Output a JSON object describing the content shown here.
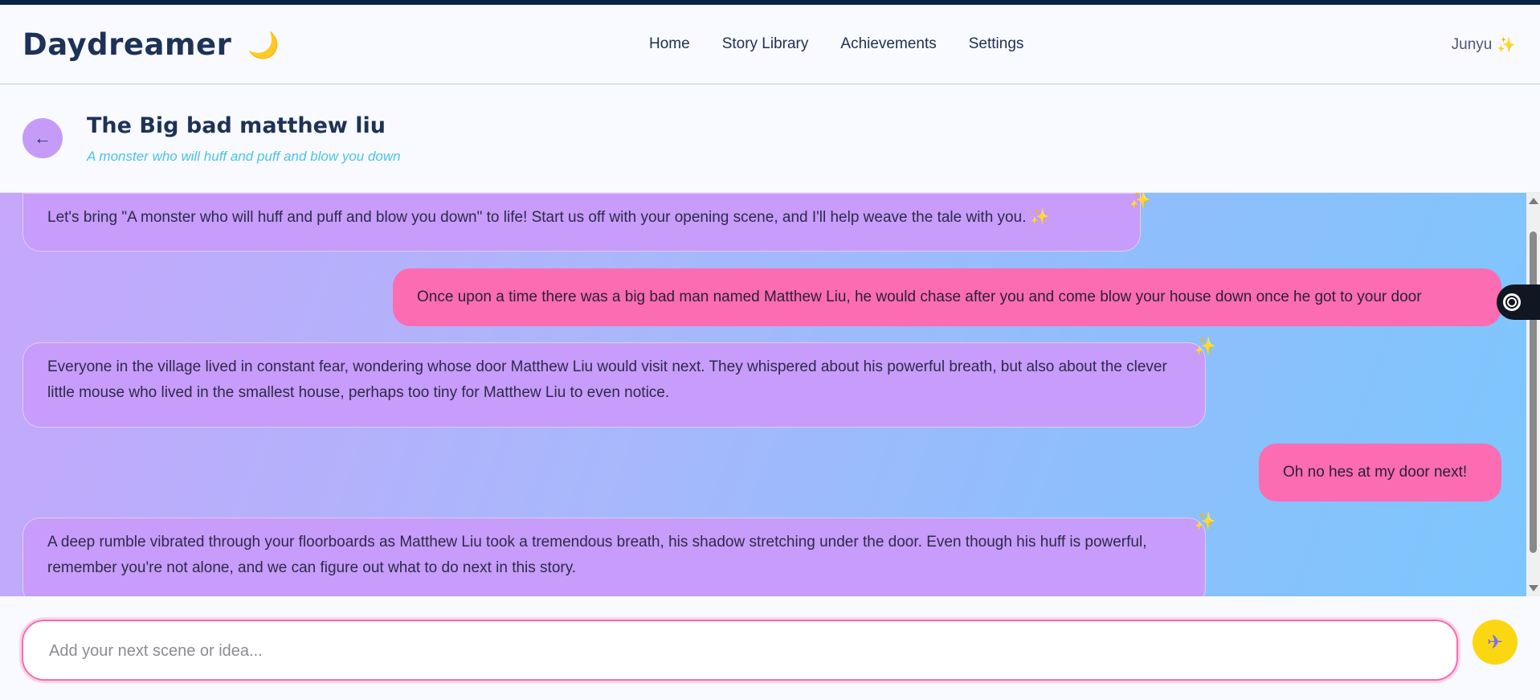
{
  "brand": {
    "name": "Daydreamer",
    "moon_icon": "🌙"
  },
  "nav": [
    "Home",
    "Story Library",
    "Achievements",
    "Settings"
  ],
  "user": {
    "name": "Junyu",
    "sparkle": "✨"
  },
  "story": {
    "back_label": "←",
    "title": "The Big bad matthew liu",
    "subtitle": "A monster who will huff and puff and blow you down"
  },
  "messages": [
    {
      "role": "ai",
      "text": "Let's bring \"A monster who will huff and puff and blow you down\" to life! Start us off with your opening scene, and I'll help weave the tale with you. ✨"
    },
    {
      "role": "user",
      "text": "Once upon a time there was a big bad man named Matthew Liu, he would chase after you and come blow your house down once he got to your door"
    },
    {
      "role": "ai",
      "text": "Everyone in the village lived in constant fear, wondering whose door Matthew Liu would visit next. They whispered about his powerful breath, but also about the clever little mouse who lived in the smallest house, perhaps too tiny for Matthew Liu to even notice."
    },
    {
      "role": "user",
      "text": "Oh no hes at my door next!"
    },
    {
      "role": "ai",
      "text": "A deep rumble vibrated through your floorboards as Matthew Liu took a tremendous breath, his shadow stretching under the door. Even though his huff is powerful, remember you're not alone, and we can figure out what to do next in this story."
    }
  ],
  "sparkle": "✨",
  "composer": {
    "placeholder": "Add your next scene or idea...",
    "value": "",
    "send_icon": "✈"
  },
  "colors": {
    "ai_bubble": "#c79cfa",
    "user_bubble": "#fc6cb2",
    "accent": "#f36cb2",
    "send": "#fbd712"
  }
}
